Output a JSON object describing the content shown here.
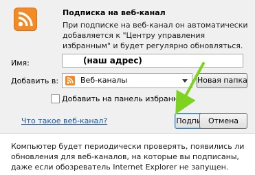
{
  "header": {
    "title": "Подписка на веб-канал",
    "description": "При подписке на веб-канал он автоматически добавляется к \"Центру управления избранным\" и будет регулярно обновляться."
  },
  "form": {
    "name_label": "Имя:",
    "name_value": "(наш адрес)",
    "add_label": "Добавить в:",
    "folder_value": "Веб-каналы",
    "new_folder_label": "Новая папка",
    "favorites_bar_checkbox_label": "Добавить на панель избранного",
    "favorites_bar_checked": false
  },
  "footer": {
    "help_link": "Что такое веб-канал?",
    "subscribe_label": "Подписаться",
    "cancel_label": "Отмена",
    "info_text": "Компьютер будет периодически проверять, появились ли обновления для веб-каналов, на которые вы подписаны, даже если обозреватель Internet Explorer не запущен."
  },
  "colors": {
    "feed_icon": "#f28a26",
    "link": "#1c5aa6",
    "annotation_arrow": "#7ed321"
  },
  "icons": {
    "feed": "rss-feed-icon",
    "dropdown": "chevron-down-icon",
    "annotation": "green-arrow-icon"
  }
}
